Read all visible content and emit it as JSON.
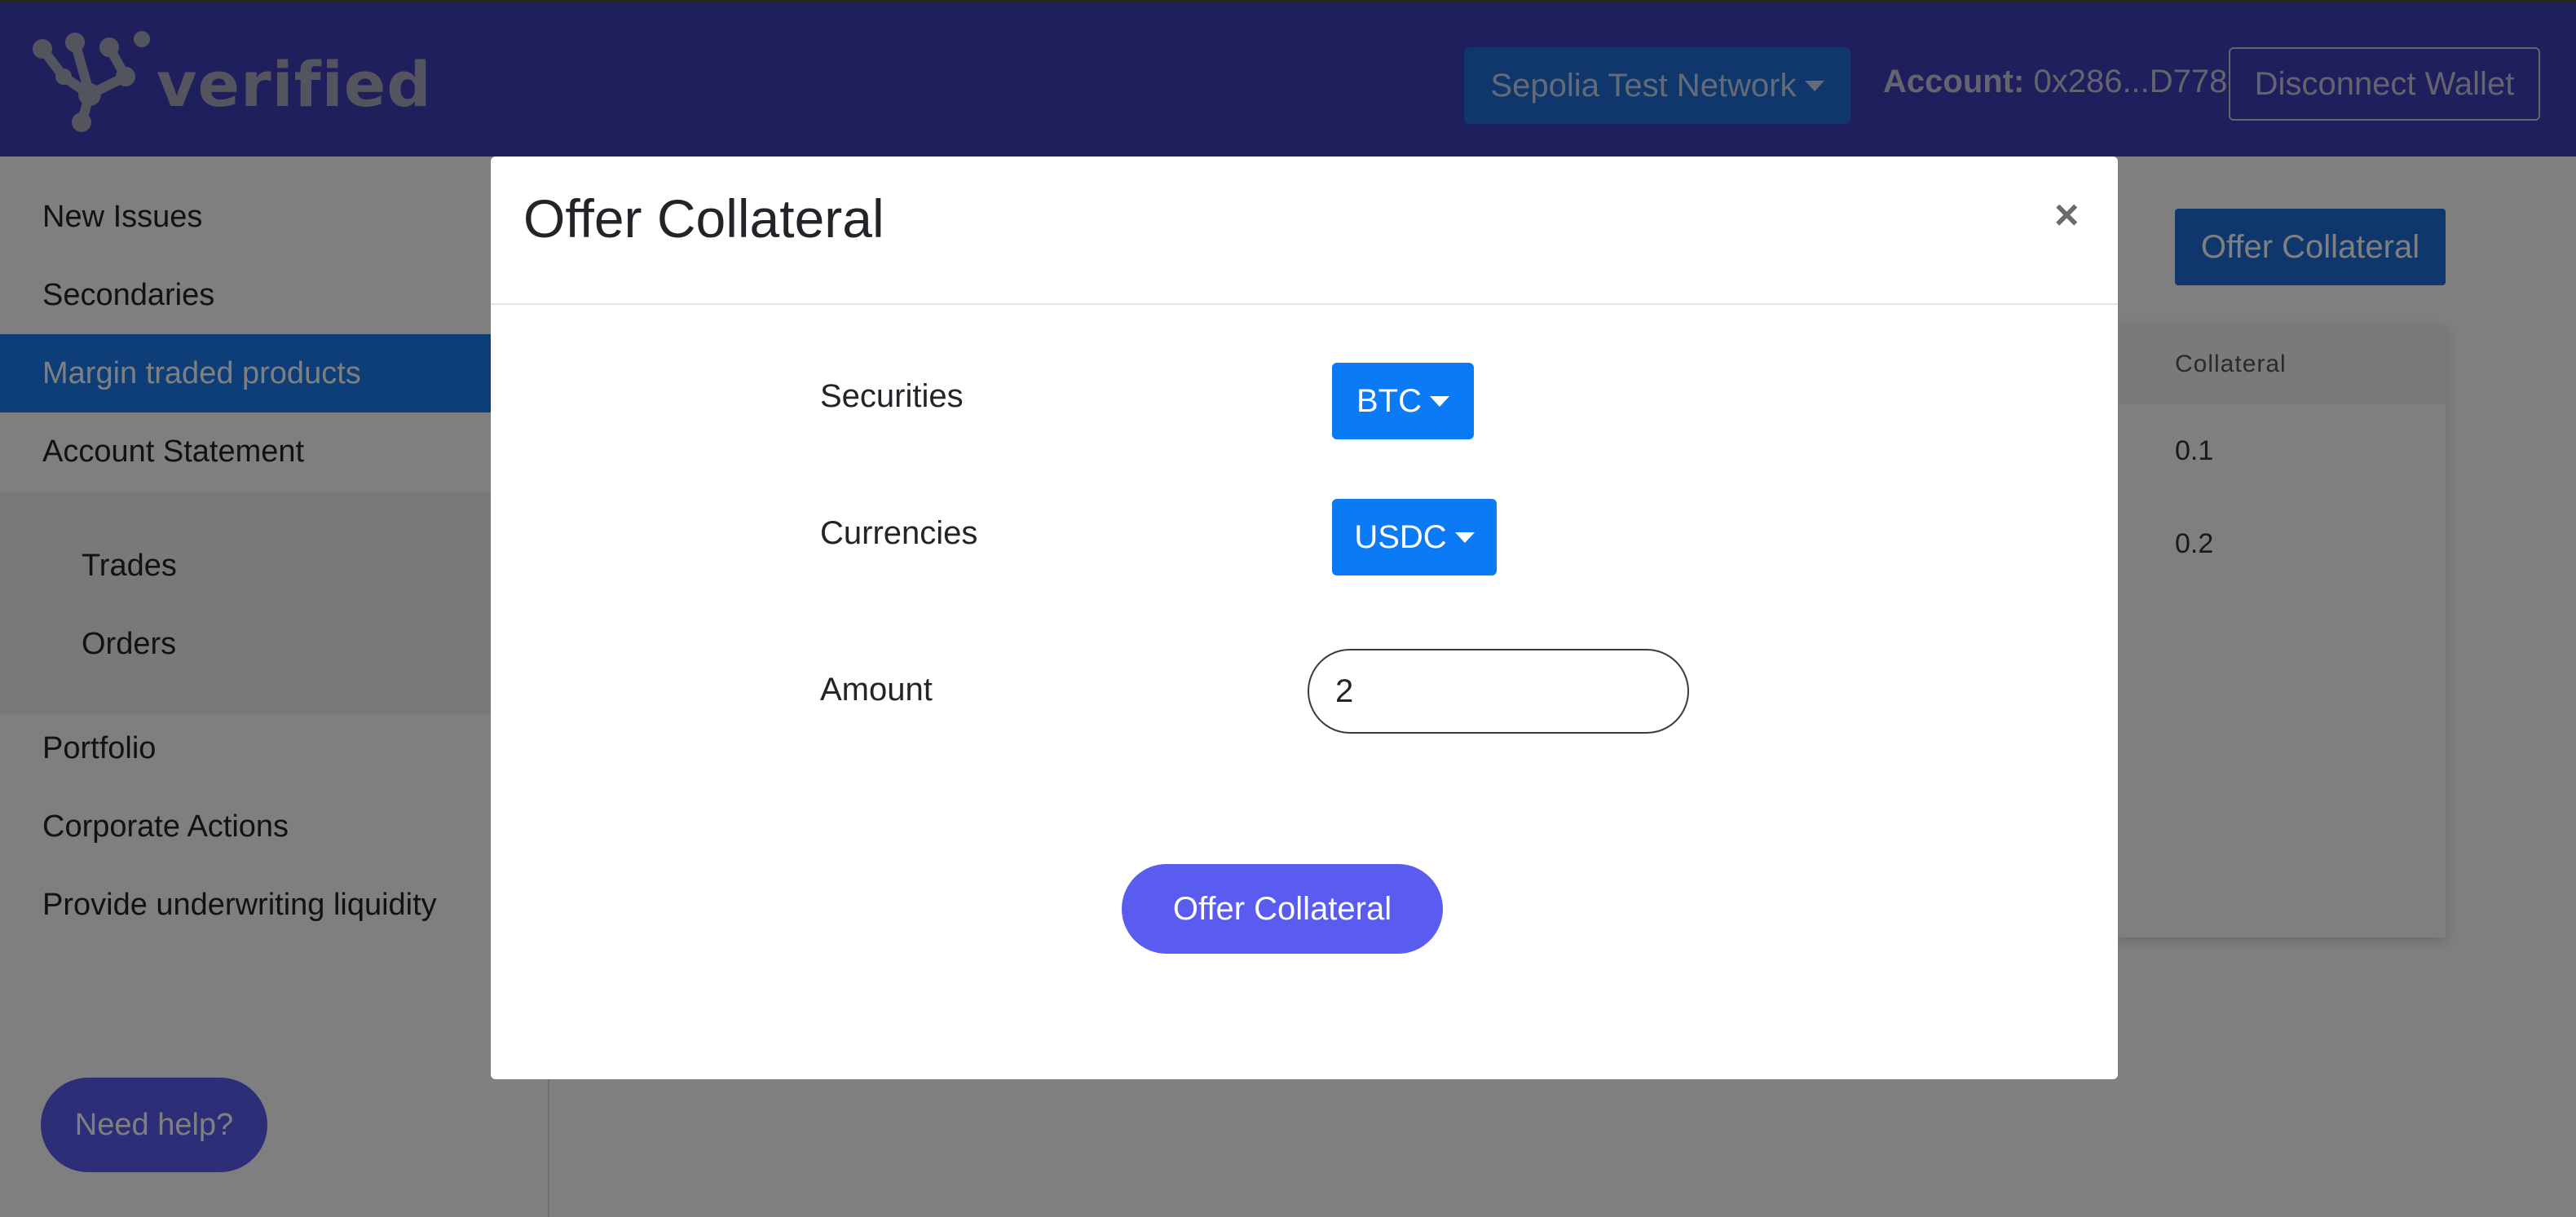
{
  "header": {
    "logo_text": "verified",
    "network_label": "Sepolia Test Network",
    "account_label": "Account:",
    "account_value": "0x286...D778",
    "disconnect_label": "Disconnect Wallet"
  },
  "sidebar": {
    "items": [
      {
        "label": "New Issues"
      },
      {
        "label": "Secondaries"
      },
      {
        "label": "Margin traded products",
        "active": true
      },
      {
        "label": "Account Statement"
      }
    ],
    "sub_items": [
      {
        "label": "Trades"
      },
      {
        "label": "Orders"
      }
    ],
    "bottom_items": [
      {
        "label": "Portfolio"
      },
      {
        "label": "Corporate Actions"
      },
      {
        "label": "Provide underwriting liquidity"
      }
    ],
    "help_label": "Need help?"
  },
  "main": {
    "offer_button_label": "Offer Collateral",
    "table": {
      "column_header": "Collateral",
      "rows": [
        "0.1",
        "0.2"
      ]
    }
  },
  "modal": {
    "title": "Offer Collateral",
    "close_glyph": "×",
    "securities_label": "Securities",
    "securities_value": "BTC",
    "currencies_label": "Currencies",
    "currencies_value": "USDC",
    "amount_label": "Amount",
    "amount_value": "2",
    "submit_label": "Offer Collateral"
  },
  "colors": {
    "header_bg": "#3d3fb8",
    "accent_blue": "#0b7bf5",
    "button_purple": "#5a5cf0"
  }
}
